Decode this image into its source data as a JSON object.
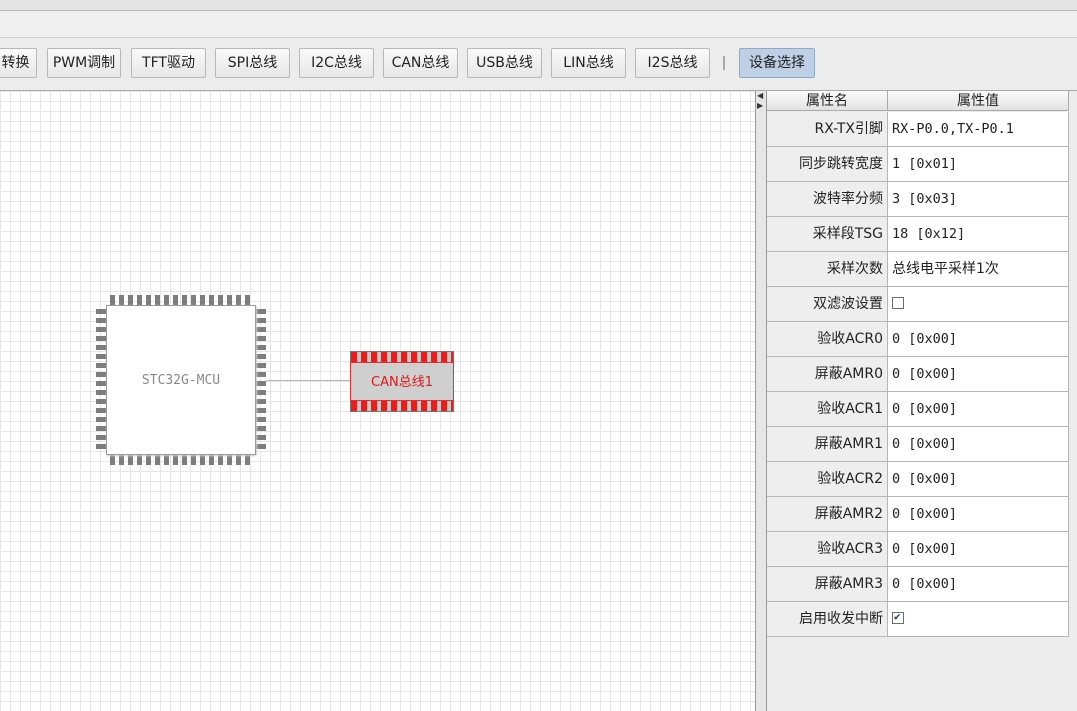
{
  "toolbar": {
    "buttons": [
      {
        "label": "转换"
      },
      {
        "label": "PWM调制"
      },
      {
        "label": "TFT驱动"
      },
      {
        "label": "SPI总线"
      },
      {
        "label": "I2C总线"
      },
      {
        "label": "CAN总线"
      },
      {
        "label": "USB总线"
      },
      {
        "label": "LIN总线"
      },
      {
        "label": "I2S总线"
      }
    ],
    "separator": "|",
    "device_select_label": "设备选择"
  },
  "canvas": {
    "mcu_label": "STC32G-MCU",
    "can_block_label": "CAN总线1"
  },
  "properties": {
    "header_name": "属性名",
    "header_value": "属性值",
    "rows": [
      {
        "name": "RX-TX引脚",
        "value": "RX-P0.0,TX-P0.1"
      },
      {
        "name": "同步跳转宽度",
        "value": "1 [0x01]"
      },
      {
        "name": "波特率分频",
        "value": "3 [0x03]"
      },
      {
        "name": "采样段TSG",
        "value": "18 [0x12]"
      },
      {
        "name": "采样次数",
        "value": "总线电平采样1次"
      },
      {
        "name": "双滤波设置",
        "checked": false
      },
      {
        "name": "验收ACR0",
        "value": "0 [0x00]"
      },
      {
        "name": "屏蔽AMR0",
        "value": "0 [0x00]"
      },
      {
        "name": "验收ACR1",
        "value": "0 [0x00]"
      },
      {
        "name": "屏蔽AMR1",
        "value": "0 [0x00]"
      },
      {
        "name": "验收ACR2",
        "value": "0 [0x00]"
      },
      {
        "name": "屏蔽AMR2",
        "value": "0 [0x00]"
      },
      {
        "name": "验收ACR3",
        "value": "0 [0x00]"
      },
      {
        "name": "屏蔽AMR3",
        "value": "0 [0x00]"
      },
      {
        "name": "启用收发中断",
        "checked": true
      }
    ]
  },
  "colors": {
    "selected_button": "#bdd0e6",
    "can_pins": "#ee1b1b",
    "can_label_text": "#e01818"
  }
}
